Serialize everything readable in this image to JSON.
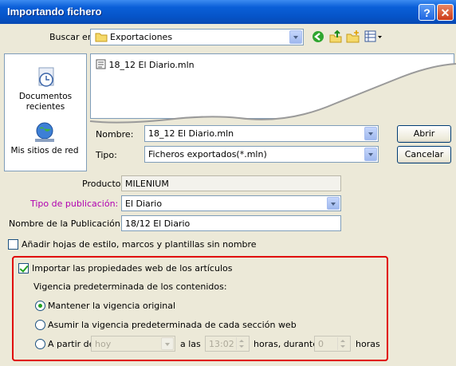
{
  "window": {
    "title": "Importando fichero",
    "help_glyph": "?",
    "close_glyph": "✕"
  },
  "lookin": {
    "label": "Buscar en:",
    "value": "Exportaciones"
  },
  "places": [
    {
      "label": "Documentos recientes",
      "icon": "recent-documents-icon"
    },
    {
      "label": "Mis sitios de red",
      "icon": "network-places-icon"
    }
  ],
  "files": [
    {
      "name": "18_12 El Diario.mln",
      "icon": "file-icon"
    }
  ],
  "filename": {
    "label": "Nombre:",
    "value": "18_12 El Diario.mln"
  },
  "filetype": {
    "label": "Tipo:",
    "value": "Ficheros exportados(*.mln)"
  },
  "buttons": {
    "open": "Abrir",
    "cancel": "Cancelar"
  },
  "producto": {
    "label": "Producto:",
    "value": "MILENIUM"
  },
  "tipo_publicacion": {
    "label": "Tipo de publicación:",
    "value": "El Diario",
    "label_color": "#b000b0"
  },
  "nombre_publicacion": {
    "label": "Nombre de la Publicación",
    "value": "18/12 El Diario"
  },
  "anadir_hojas": {
    "label": "Añadir hojas de estilo, marcos y plantillas sin nombre",
    "checked": false
  },
  "importar_web": {
    "label": "Importar las propiedades web de los artículos",
    "checked": true
  },
  "vigencia": {
    "heading": "Vigencia predeterminada de los contenidos:",
    "options": [
      {
        "label": "Mantener la vigencia original",
        "selected": true
      },
      {
        "label": "Asumir la vigencia predeterminada de cada sección web",
        "selected": false
      },
      {
        "label": "A partir de",
        "selected": false
      }
    ],
    "from_value": "hoy",
    "at_label": "a las",
    "time_value": "13:02",
    "hours_during_label": "horas, durante",
    "duration_value": "0",
    "hours_label": "horas"
  },
  "highlight_color": "#e00000"
}
